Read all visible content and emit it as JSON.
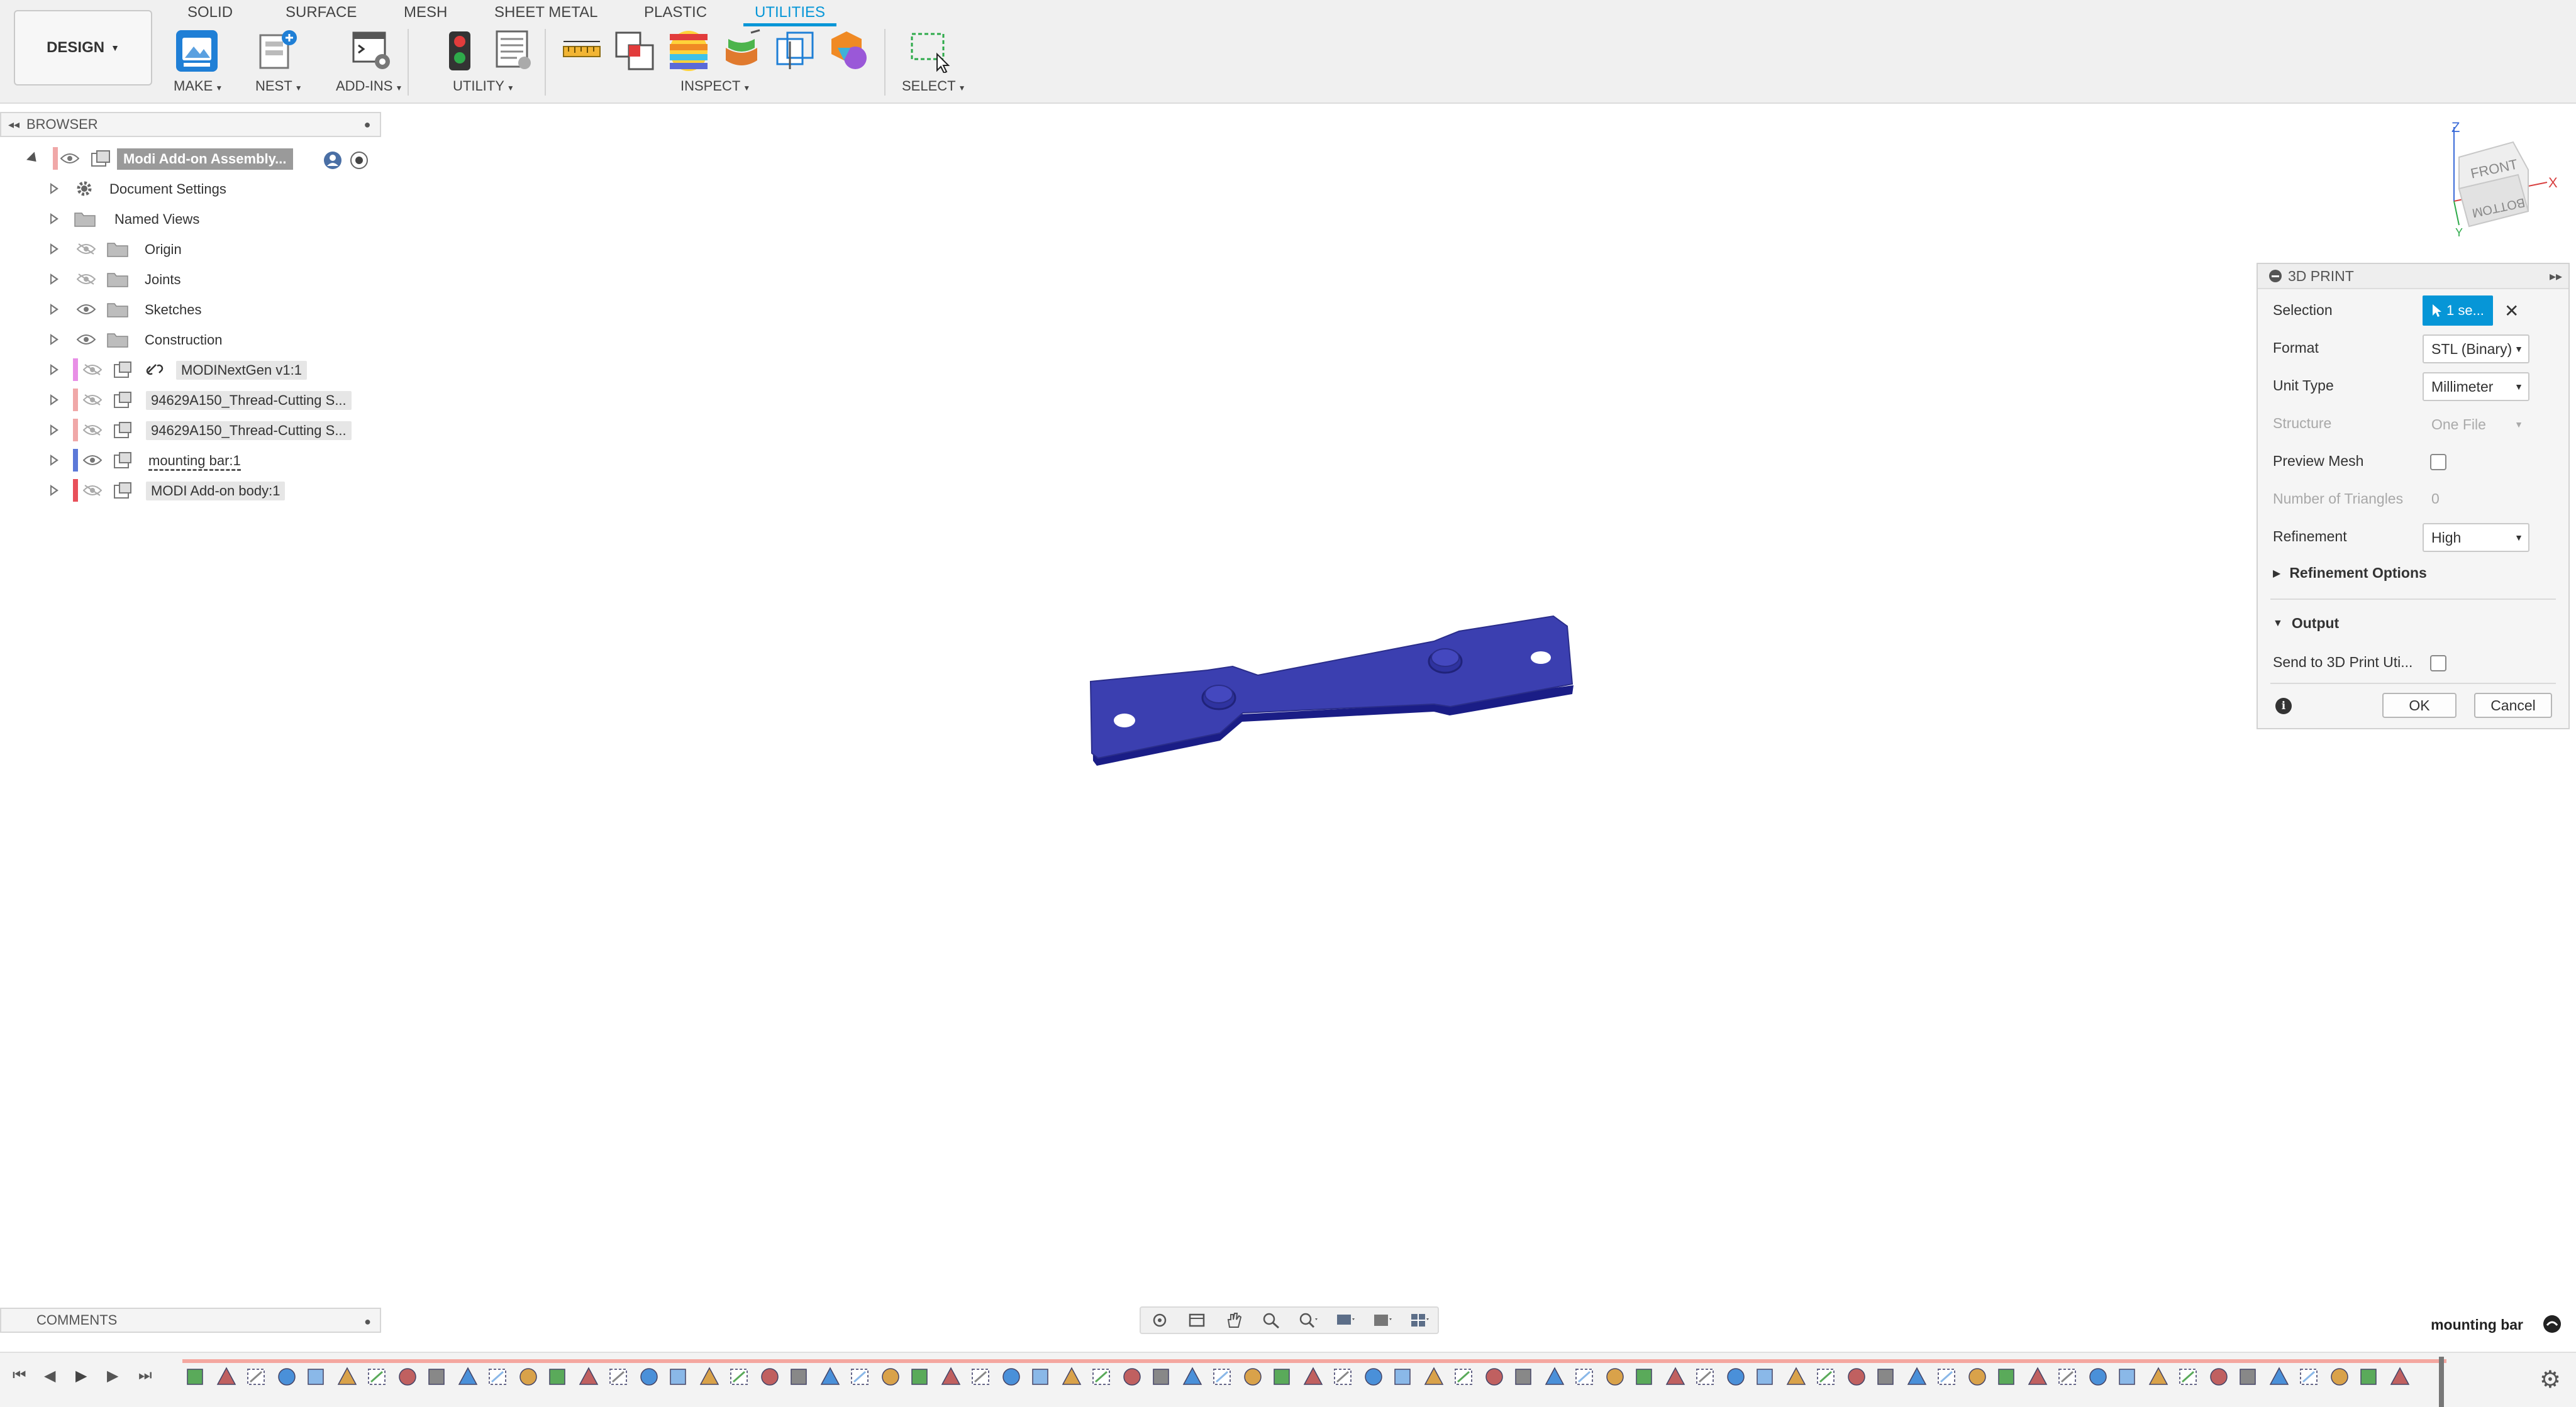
{
  "toolbar": {
    "workspace": "DESIGN",
    "tabs": [
      {
        "label": "SOLID",
        "active": false
      },
      {
        "label": "SURFACE",
        "active": false
      },
      {
        "label": "MESH",
        "active": false
      },
      {
        "label": "SHEET METAL",
        "active": false
      },
      {
        "label": "PLASTIC",
        "active": false
      },
      {
        "label": "UTILITIES",
        "active": true
      }
    ],
    "groups": {
      "make": "MAKE",
      "nest": "NEST",
      "addins": "ADD-INS",
      "utility": "UTILITY",
      "inspect": "INSPECT",
      "select": "SELECT"
    },
    "accent_color": "#0696d7"
  },
  "browser": {
    "title": "BROWSER",
    "root": {
      "label": "Modi Add-on Assembly...",
      "icon": "assembly-icon"
    },
    "items": [
      {
        "label": "Document Settings",
        "icon": "gear-icon",
        "color": null
      },
      {
        "label": "Named Views",
        "icon": "folder-icon",
        "color": null
      },
      {
        "label": "Origin",
        "icon": "folder-icon",
        "color": null
      },
      {
        "label": "Joints",
        "icon": "folder-icon",
        "color": null
      },
      {
        "label": "Sketches",
        "icon": "folder-icon",
        "color": null
      },
      {
        "label": "Construction",
        "icon": "folder-icon",
        "color": null
      },
      {
        "label": "MODINextGen v1:1",
        "icon": "link-icon",
        "color": "#e88fe6"
      },
      {
        "label": "94629A150_Thread-Cutting S...",
        "icon": "component-icon",
        "color": "#f0a8a8"
      },
      {
        "label": "94629A150_Thread-Cutting S...",
        "icon": "component-icon",
        "color": "#f0a8a8"
      },
      {
        "label": "mounting bar:1",
        "icon": "component-icon",
        "color": "#5c79d8"
      },
      {
        "label": "MODI Add-on  body:1",
        "icon": "component-icon",
        "color": "#e8505a"
      }
    ]
  },
  "viewcube": {
    "front": "FRONT",
    "bottom": "BOTTOM",
    "axis_z": "Z",
    "axis_x": "X",
    "axis_y": "Y"
  },
  "dialog": {
    "title": "3D PRINT",
    "selection_label": "Selection",
    "selection_value": "1 se...",
    "format_label": "Format",
    "format_value": "STL (Binary)",
    "unit_label": "Unit Type",
    "unit_value": "Millimeter",
    "structure_label": "Structure",
    "structure_value": "One File",
    "preview_label": "Preview Mesh",
    "preview_checked": false,
    "triangles_label": "Number of Triangles",
    "triangles_value": "0",
    "refinement_label": "Refinement",
    "refinement_value": "High",
    "refinement_options": "Refinement Options",
    "output": "Output",
    "send_label": "Send to 3D Print Uti...",
    "send_checked": false,
    "ok": "OK",
    "cancel": "Cancel"
  },
  "comments": {
    "title": "COMMENTS"
  },
  "status": {
    "active_component": "mounting bar"
  },
  "model": {
    "color": "#3b3fb0"
  }
}
